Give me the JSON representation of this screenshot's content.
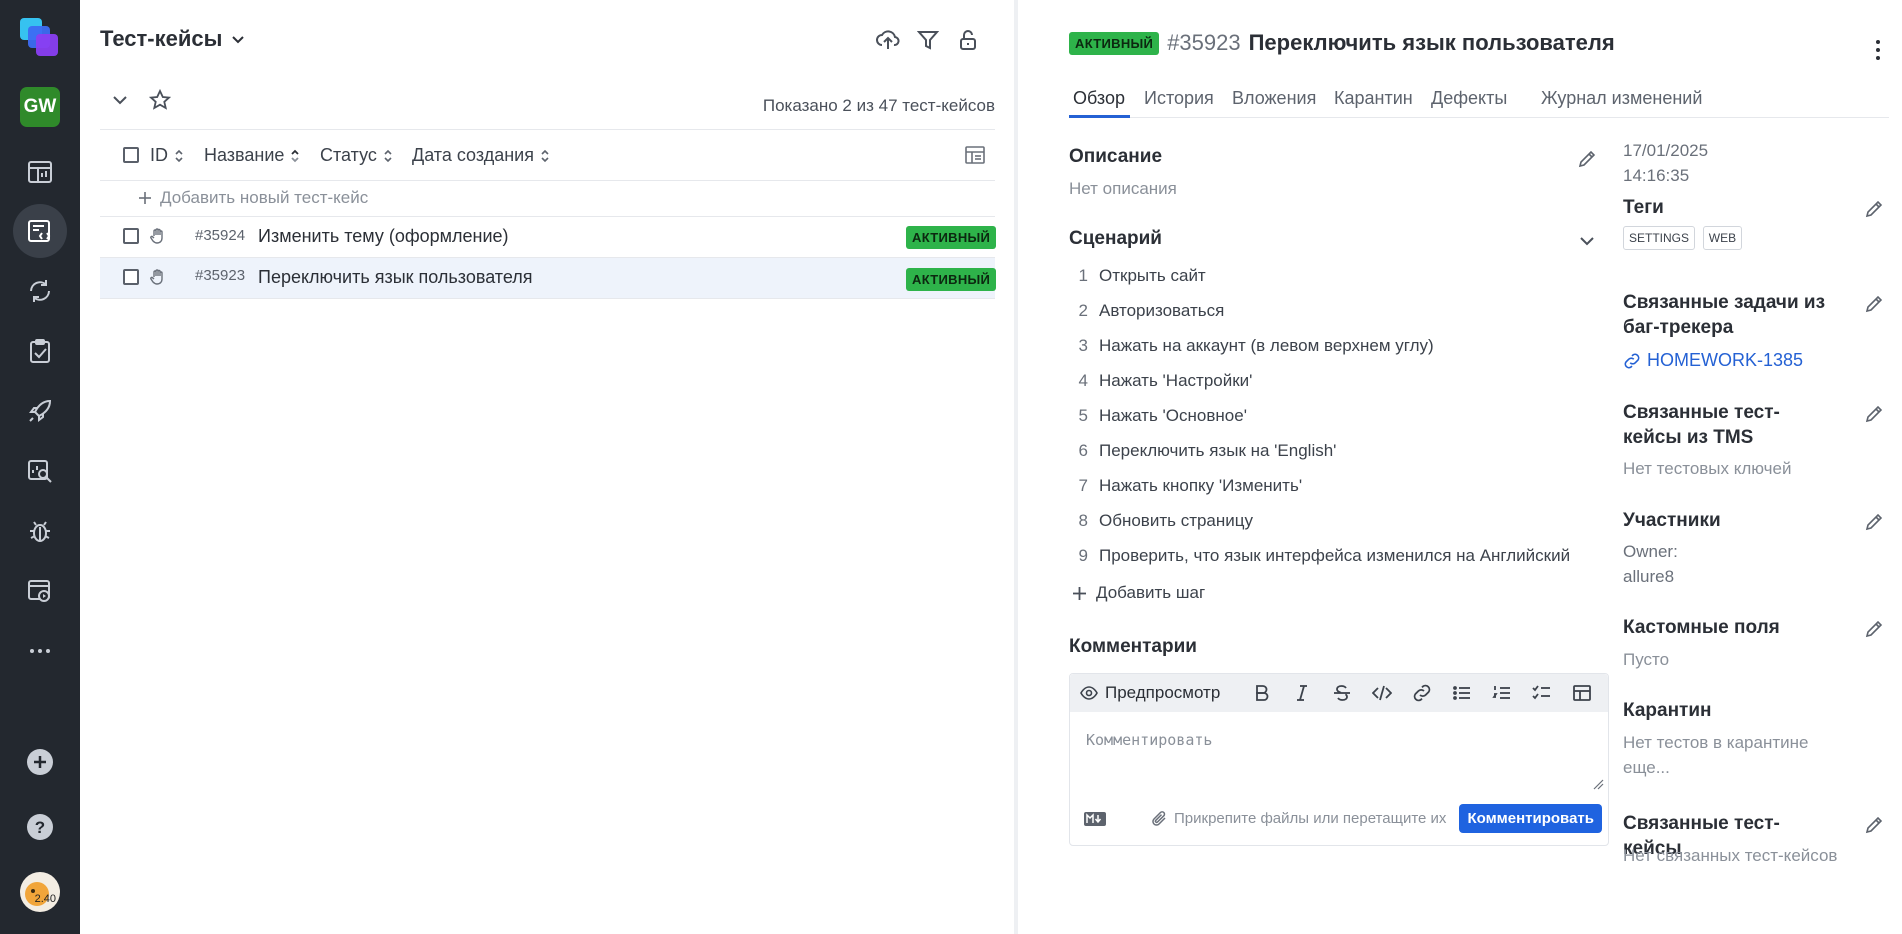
{
  "sidebar": {
    "workspace_initials": "GW",
    "items": [
      {
        "name": "dashboard-icon"
      },
      {
        "name": "test-cases-icon",
        "active": true
      },
      {
        "name": "launches-icon"
      },
      {
        "name": "test-plans-icon"
      },
      {
        "name": "rocket-icon"
      },
      {
        "name": "analytics-icon"
      },
      {
        "name": "bug-icon"
      },
      {
        "name": "jobs-icon"
      },
      {
        "name": "more-icon"
      }
    ],
    "avatar_text": "2.40"
  },
  "left_panel": {
    "title": "Тест-кейсы",
    "shown_count": "Показано 2 из 47 тест-кейсов",
    "columns": [
      "ID",
      "Название",
      "Статус",
      "Дата создания"
    ],
    "add_label": "Добавить новый тест-кейс",
    "rows": [
      {
        "id": "#35924",
        "name": "Изменить тему (оформление)",
        "status": "АКТИВНЫЙ",
        "selected": false
      },
      {
        "id": "#35923",
        "name": "Переключить язык пользователя",
        "status": "АКТИВНЫЙ",
        "selected": true
      }
    ]
  },
  "detail": {
    "status": "АКТИВНЫЙ",
    "id": "#35923",
    "title": "Переключить язык пользователя",
    "tabs": [
      "Обзор",
      "История",
      "Вложения",
      "Карантин",
      "Дефекты",
      "Журнал изменений"
    ],
    "description_title": "Описание",
    "description_empty": "Нет описания",
    "scenario_title": "Сценарий",
    "steps": [
      "Открыть сайт",
      "Авторизоваться",
      "Нажать на аккаунт (в левом верхнем углу)",
      "Нажать 'Настройки'",
      "Нажать 'Основное'",
      "Переключить язык на 'English'",
      "Нажать кнопку 'Изменить'",
      "Обновить страницу",
      "Проверить, что язык интерфейса изменился на Английский"
    ],
    "add_step": "Добавить шаг",
    "comments_title": "Комментарии",
    "preview_label": "Предпросмотр",
    "comment_placeholder": "Комментировать",
    "attach_label": "Прикрепите файлы или перетащите их",
    "comment_button": "Комментировать",
    "created_date": "17/01/2025",
    "created_time": "14:16:35",
    "tags_title": "Теги",
    "tags": [
      "SETTINGS",
      "WEB"
    ],
    "issues_title": "Связанные задачи из баг-трекера",
    "issue_link": "HOMEWORK-1385",
    "tms_title": "Связанные тест-кейсы из TMS",
    "tms_empty": "Нет тестовых ключей",
    "members_title": "Участники",
    "members_role": "Owner:",
    "members_name": "allure8",
    "custom_title": "Кастомные поля",
    "custom_empty": "Пусто",
    "quarantine_title": "Карантин",
    "quarantine_empty": "Нет тестов в карантине еще...",
    "related_title": "Связанные тест-кейсы",
    "related_empty": "Нет связанных тест-кейсов"
  },
  "colors": {
    "sidebar_bg": "#23282f",
    "accent": "#2461d4",
    "status_active": "#2eb34a",
    "selected_row": "#eef3fb"
  }
}
